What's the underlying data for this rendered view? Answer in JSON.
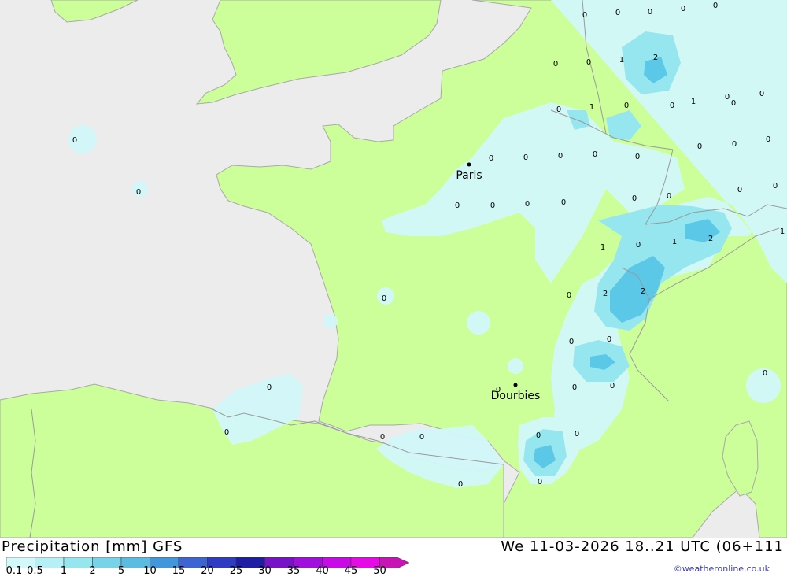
{
  "header": {
    "title": "Precipitation [mm] GFS",
    "run_info": "We 11-03-2026 18..21 UTC (06+111",
    "credit": "©weatheronline.co.uk"
  },
  "legend": {
    "labels": [
      "0.1",
      "0.5",
      "1",
      "2",
      "5",
      "10",
      "15",
      "20",
      "25",
      "30",
      "35",
      "40",
      "45",
      "50"
    ],
    "colors": [
      "#d2f8fa",
      "#b4f0f5",
      "#96e6f0",
      "#78d2e8",
      "#5abce0",
      "#4196dc",
      "#3c64d2",
      "#2d3cc3",
      "#1e1ea5",
      "#7814c8",
      "#a00fdc",
      "#c80ae6",
      "#e60ae6",
      "#c814b4"
    ]
  },
  "map": {
    "colors": {
      "sea": "#ececec",
      "land": "#ccff99",
      "precip_light": "#d2f8fa",
      "precip_mid": "#96e6f0",
      "precip_heavy": "#5ac8e6"
    },
    "cities": [
      {
        "name": "Paris"
      },
      {
        "name": "Dourbies"
      }
    ],
    "values": [
      "0",
      "0",
      "0",
      "0",
      "0",
      "2",
      "0",
      "0",
      "1",
      "0",
      "0",
      "1",
      "1",
      "0",
      "0",
      "0",
      "0",
      "0",
      "0",
      "0",
      "0",
      "0",
      "0",
      "0",
      "0",
      "0",
      "0",
      "0",
      "0",
      "0",
      "1",
      "0",
      "1",
      "2",
      "1",
      "2",
      "2",
      "0",
      "0",
      "0",
      "0",
      "0",
      "0",
      "0",
      "0",
      "0",
      "0",
      "0",
      "0",
      "0",
      "0",
      "0",
      "0",
      "0",
      "0",
      "0",
      "0",
      "0"
    ]
  }
}
